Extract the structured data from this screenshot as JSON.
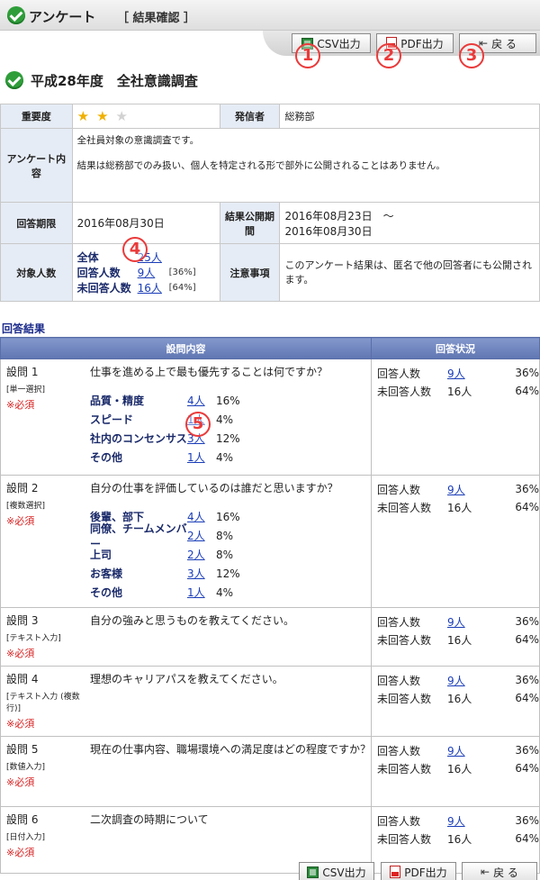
{
  "header": {
    "title": "アンケート",
    "subtitle": "［ 結果確認 ］"
  },
  "toolbar": {
    "csv_label": "CSV出力",
    "pdf_label": "PDF出力",
    "back_label": "戻 る"
  },
  "markers": {
    "m1": "1",
    "m2": "2",
    "m3": "3",
    "m4": "4",
    "m5": "5"
  },
  "survey": {
    "title": "平成28年度　全社意識調査"
  },
  "info": {
    "importance_label": "重要度",
    "importance_rating": 2,
    "importance_max": 3,
    "sender_label": "発信者",
    "sender": "総務部",
    "content_label": "アンケート内容",
    "content_line1": "全社員対象の意識調査です。",
    "content_line2": "結果は総務部でのみ扱い、個人を特定される形で部外に公開されることはありません。",
    "deadline_label": "回答期限",
    "deadline": "2016年08月30日",
    "publish_label": "結果公開期間",
    "publish_line1": "2016年08月23日　～",
    "publish_line2": "2016年08月30日",
    "targets_label": "対象人数",
    "total_label": "全体",
    "total_value": "25人",
    "answered_label": "回答人数",
    "answered_value": "9人",
    "answered_pct": "[36%]",
    "unanswered_label": "未回答人数",
    "unanswered_value": "16人",
    "unanswered_pct": "[64%]",
    "notes_label": "注意事項",
    "notes": "このアンケート結果は、匿名で他の回答者にも公開されます。"
  },
  "results": {
    "section_label": "回答結果",
    "col_question": "設問内容",
    "col_status": "回答状況",
    "questions": [
      {
        "no": "設問 1",
        "type": "[単一選択]",
        "required": "※必須",
        "text": "仕事を進める上で最も優先することは何ですか？",
        "options": [
          {
            "label": "品質・精度",
            "count": "4人",
            "pct": "16%"
          },
          {
            "label": "スピード",
            "count": "1人",
            "pct": "4%"
          },
          {
            "label": "社内のコンセンサス",
            "count": "3人",
            "pct": "12%"
          },
          {
            "label": "その他",
            "count": "1人",
            "pct": "4%"
          }
        ],
        "answered_label": "回答人数",
        "answered": "9人",
        "answered_pct": "36%",
        "unanswered_label": "未回答人数",
        "unanswered": "16人",
        "unanswered_pct": "64%"
      },
      {
        "no": "設問 2",
        "type": "[複数選択]",
        "required": "※必須",
        "text": "自分の仕事を評価しているのは誰だと思いますか？",
        "options": [
          {
            "label": "後輩、部下",
            "count": "4人",
            "pct": "16%"
          },
          {
            "label": "同僚、チームメンバー",
            "count": "2人",
            "pct": "8%"
          },
          {
            "label": "上司",
            "count": "2人",
            "pct": "8%"
          },
          {
            "label": "お客様",
            "count": "3人",
            "pct": "12%"
          },
          {
            "label": "その他",
            "count": "1人",
            "pct": "4%"
          }
        ],
        "answered_label": "回答人数",
        "answered": "9人",
        "answered_pct": "36%",
        "unanswered_label": "未回答人数",
        "unanswered": "16人",
        "unanswered_pct": "64%"
      },
      {
        "no": "設問 3",
        "type": "[テキスト入力]",
        "required": "※必須",
        "text": "自分の強みと思うものを教えてください。",
        "answered_label": "回答人数",
        "answered": "9人",
        "answered_pct": "36%",
        "unanswered_label": "未回答人数",
        "unanswered": "16人",
        "unanswered_pct": "64%"
      },
      {
        "no": "設問 4",
        "type": "[テキスト入力 (複数行)]",
        "required": "※必須",
        "text": "理想のキャリアパスを教えてください。",
        "answered_label": "回答人数",
        "answered": "9人",
        "answered_pct": "36%",
        "unanswered_label": "未回答人数",
        "unanswered": "16人",
        "unanswered_pct": "64%"
      },
      {
        "no": "設問 5",
        "type": "[数値入力]",
        "required": "※必須",
        "text": "現在の仕事内容、職場環境への満足度はどの程度ですか？",
        "answered_label": "回答人数",
        "answered": "9人",
        "answered_pct": "36%",
        "unanswered_label": "未回答人数",
        "unanswered": "16人",
        "unanswered_pct": "64%"
      },
      {
        "no": "設問 6",
        "type": "[日付入力]",
        "required": "※必須",
        "text": "二次調査の時期について",
        "answered_label": "回答人数",
        "answered": "9人",
        "answered_pct": "36%",
        "unanswered_label": "未回答人数",
        "unanswered": "16人",
        "unanswered_pct": "64%"
      }
    ]
  }
}
